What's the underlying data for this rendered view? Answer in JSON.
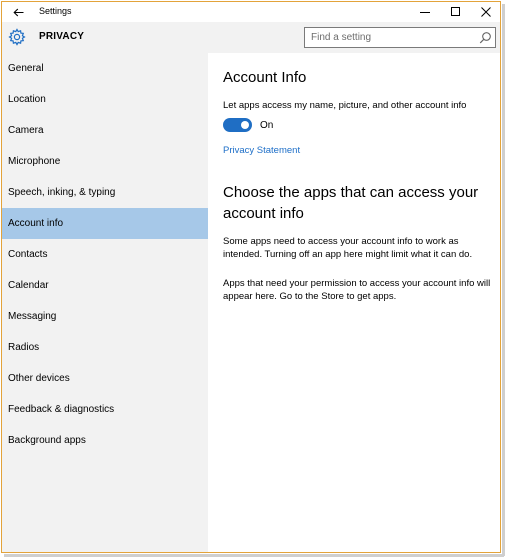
{
  "window": {
    "title": "Settings",
    "back_icon": "back-arrow-icon",
    "controls": [
      "minimize-icon",
      "maximize-icon",
      "close-icon"
    ]
  },
  "header": {
    "icon": "gear-icon",
    "section": "PRIVACY",
    "search_placeholder": "Find a setting"
  },
  "sidebar": {
    "items": [
      {
        "label": "General"
      },
      {
        "label": "Location"
      },
      {
        "label": "Camera"
      },
      {
        "label": "Microphone"
      },
      {
        "label": "Speech, inking, & typing"
      },
      {
        "label": "Account info",
        "selected": true
      },
      {
        "label": "Contacts"
      },
      {
        "label": "Calendar"
      },
      {
        "label": "Messaging"
      },
      {
        "label": "Radios"
      },
      {
        "label": "Other devices"
      },
      {
        "label": "Feedback & diagnostics"
      },
      {
        "label": "Background apps"
      }
    ]
  },
  "content": {
    "title": "Account Info",
    "setting_description": "Let apps access my name, picture, and other account info",
    "toggle_state": "On",
    "privacy_link": "Privacy Statement",
    "section_heading": "Choose the apps that can access your account info",
    "paragraph_1": "Some apps need to access your account info to work as intended. Turning off an app here might limit what it can do.",
    "paragraph_2": "Apps that need your permission to access your account info will appear here. Go to the Store to get apps."
  },
  "colors": {
    "accent": "#1f6ec4",
    "link": "#1e6fc8",
    "selected_nav": "#a6c8e8",
    "sidebar_bg": "#f2f2f2",
    "window_border": "#e3a33a"
  }
}
